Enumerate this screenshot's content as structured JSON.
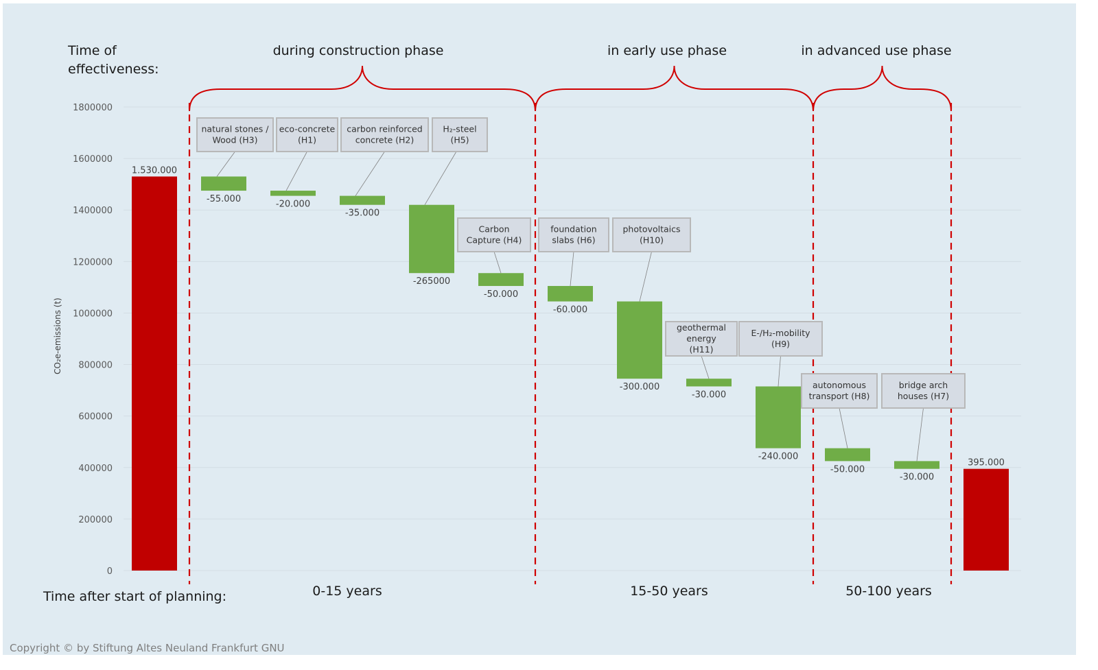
{
  "chart_data": {
    "type": "waterfall",
    "ylabel": "CO₂e-emissions (t)",
    "ylim": [
      0,
      1800000
    ],
    "yticks": [
      "0",
      "200000",
      "400000",
      "600000",
      "800000",
      "1000000",
      "1200000",
      "1400000",
      "1600000",
      "1800000"
    ],
    "grid": true,
    "start": {
      "value": 1530000,
      "label": "1.530.000"
    },
    "end": {
      "value": 395000,
      "label": "395.000"
    },
    "steps": [
      {
        "name": "natural stones / Wood (H3)",
        "lines": [
          "natural stones /",
          "Wood (H3)"
        ],
        "value": -55000,
        "label": "-55.000"
      },
      {
        "name": "eco-concrete (H1)",
        "lines": [
          "eco-concrete",
          "(H1)"
        ],
        "value": -20000,
        "label": "-20.000"
      },
      {
        "name": "carbon reinforced concrete (H2)",
        "lines": [
          "carbon reinforced",
          "concrete (H2)"
        ],
        "value": -35000,
        "label": "-35.000"
      },
      {
        "name": "H₂-steel (H5)",
        "lines": [
          "H₂-steel",
          "(H5)"
        ],
        "value": -265000,
        "label": "-265000"
      },
      {
        "name": "Carbon Capture (H4)",
        "lines": [
          "Carbon",
          "Capture (H4)"
        ],
        "value": -50000,
        "label": "-50.000"
      },
      {
        "name": "foundation slabs (H6)",
        "lines": [
          "foundation",
          "slabs (H6)"
        ],
        "value": -60000,
        "label": "-60.000"
      },
      {
        "name": "photovoltaics (H10)",
        "lines": [
          "photovoltaics",
          "(H10)"
        ],
        "value": -300000,
        "label": "-300.000"
      },
      {
        "name": "geothermal energy (H11)",
        "lines": [
          "geothermal",
          "energy",
          "(H11)"
        ],
        "value": -30000,
        "label": "-30.000"
      },
      {
        "name": "E-/H₂-mobility (H9)",
        "lines": [
          "E-/H₂-mobility",
          "(H9)"
        ],
        "value": -240000,
        "label": "-240.000"
      },
      {
        "name": "autonomous transport (H8)",
        "lines": [
          "autonomous",
          "transport (H8)"
        ],
        "value": -50000,
        "label": "-50.000"
      },
      {
        "name": "bridge arch houses (H7)",
        "lines": [
          "bridge arch",
          "houses (H7)"
        ],
        "value": -30000,
        "label": "-30.000"
      }
    ],
    "colors": {
      "total": "#c00000",
      "decrease": "#70ad47",
      "phase_line": "#d00000",
      "background": "#e0ebf2"
    },
    "phases": [
      {
        "name": "during construction phase",
        "period": "0-15 years"
      },
      {
        "name": "in early use phase",
        "period": "15-50 years"
      },
      {
        "name": "in advanced use phase",
        "period": "50-100 years"
      }
    ]
  },
  "labels": {
    "time_of_effectiveness_1": "Time of",
    "time_of_effectiveness_2": "effectiveness:",
    "time_after_start": "Time after start of planning:"
  },
  "copyright": "Copyright © by Stiftung Altes Neuland Frankfurt GNU"
}
